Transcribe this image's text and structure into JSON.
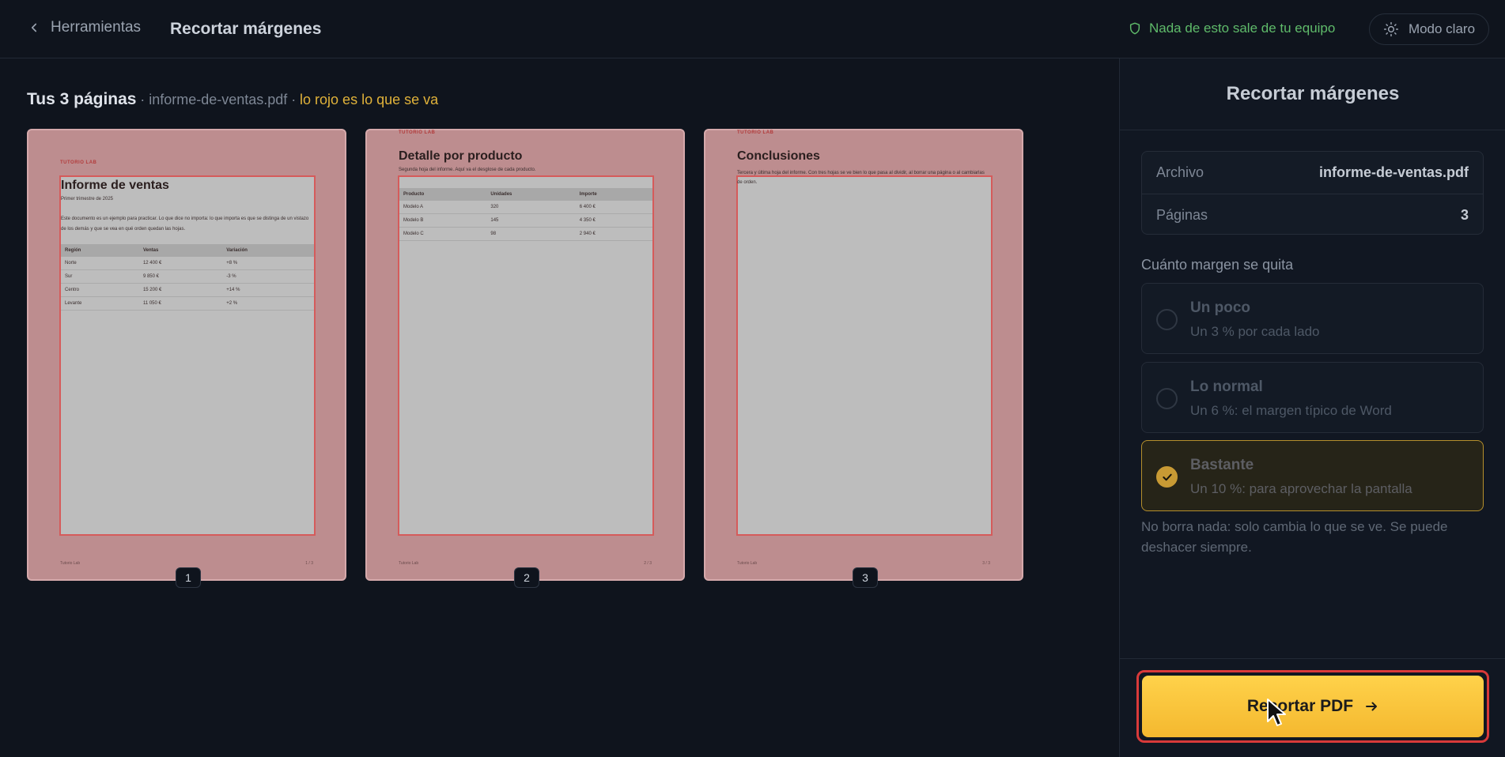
{
  "header": {
    "back_label": "Herramientas",
    "title": "Recortar márgenes",
    "privacy": "Nada de esto sale de tu equipo",
    "mode": "Modo claro"
  },
  "main": {
    "pages_title": "Tus 3 páginas",
    "file_name": "· informe-de-ventas.pdf ·",
    "hint": "lo rojo es lo que se va"
  },
  "pages": [
    {
      "number": "1",
      "brand": "TUTORIO LAB",
      "title": "Informe de ventas",
      "subtitle": "Primer trimestre de 2025",
      "body": "Este documento es un ejemplo para practicar. Lo que dice no importa: lo que importa es que se distinga de un vistazo de los demás y que se vea en qué orden quedan las hojas.",
      "table": {
        "headers": [
          "Región",
          "Ventas",
          "Variación"
        ],
        "rows": [
          [
            "Norte",
            "12 400 €",
            "+8 %"
          ],
          [
            "Sur",
            "9 850 €",
            "-3 %"
          ],
          [
            "Centro",
            "15 200 €",
            "+14 %"
          ],
          [
            "Levante",
            "11 050 €",
            "+2 %"
          ]
        ]
      },
      "footer_left": "Tutorio Lab",
      "footer_right": "1 / 3"
    },
    {
      "number": "2",
      "brand": "TUTORIO LAB",
      "title": "Detalle por producto",
      "body": "Segunda hoja del informe. Aquí va el desglose de cada producto.",
      "table": {
        "headers": [
          "Producto",
          "Unidades",
          "Importe"
        ],
        "rows": [
          [
            "Modelo A",
            "320",
            "6 400 €"
          ],
          [
            "Modelo B",
            "145",
            "4 350 €"
          ],
          [
            "Modelo C",
            "98",
            "2 940 €"
          ]
        ]
      },
      "footer_left": "Tutorio Lab",
      "footer_right": "2 / 3"
    },
    {
      "number": "3",
      "brand": "TUTORIO LAB",
      "title": "Conclusiones",
      "body": "Tercera y última hoja del informe. Con tres hojas se ve bien lo que pasa al dividir, al borrar una página o al cambiarlas de orden.",
      "footer_left": "Tutorio Lab",
      "footer_right": "3 / 3"
    }
  ],
  "panel": {
    "title": "Recortar márgenes",
    "info": [
      {
        "key": "Archivo",
        "value": "informe-de-ventas.pdf"
      },
      {
        "key": "Páginas",
        "value": "3"
      }
    ],
    "section_label": "Cuánto margen se quita",
    "options": [
      {
        "label": "Un poco",
        "desc": "Un 3 % por cada lado",
        "selected": false
      },
      {
        "label": "Lo normal",
        "desc": "Un 6 %: el margen típico de Word",
        "selected": false
      },
      {
        "label": "Bastante",
        "desc": "Un 10 %: para aprovechar la pantalla",
        "selected": true
      }
    ],
    "note": "No borra nada: solo cambia lo que se ve. Se puede deshacer siempre.",
    "cta": "Recortar PDF"
  },
  "colors": {
    "accent": "#f4b82f",
    "success": "#5fbb6a",
    "crop_overlay": "#bd8d8f",
    "crop_border": "#d55b5b",
    "highlight": "#d93a3a"
  }
}
